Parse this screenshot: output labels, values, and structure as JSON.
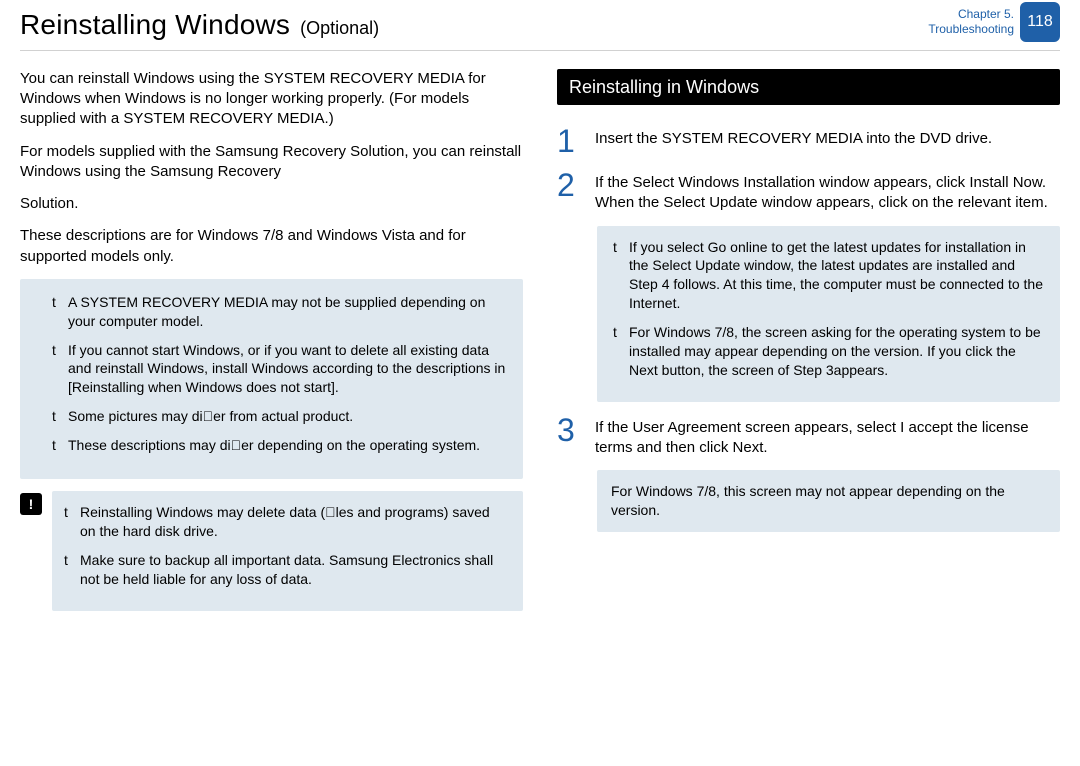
{
  "header": {
    "title": "Reinstalling Windows",
    "optional": "(Optional)",
    "chapter_line1": "Chapter 5.",
    "chapter_line2": "Troubleshooting",
    "page_number": "118"
  },
  "left": {
    "p1": "You can reinstall Windows using the SYSTEM RECOVERY MEDIA for Windows when Windows is no longer working properly. (For models supplied with a SYSTEM RECOVERY MEDIA.)",
    "p2": "For models supplied with the Samsung Recovery Solution, you can reinstall Windows using the Samsung Recovery",
    "p3": "Solution.",
    "p4": "These descriptions are for Windows 7/8 and Windows Vista and for supported models only.",
    "notes": {
      "n1": "A SYSTEM RECOVERY MEDIA may not be supplied depending on your computer model.",
      "n2": "If you cannot start Windows, or if you want to delete all existing data and reinstall Windows, install Windows according to the descriptions in [Reinstalling when Windows does not start].",
      "n3": "Some pictures may di\u0000er from actual product.",
      "n4": "These descriptions may di\u0000er depending on the operating system."
    },
    "warn": {
      "icon_label": "!",
      "w1": "Reinstalling Windows may delete data (\u0000les and programs) saved on the hard disk drive.",
      "w2": "Make sure to backup all important data. Samsung Electronics shall not be held liable for any loss of data."
    }
  },
  "right": {
    "section_title": "Reinstalling in Windows",
    "steps": {
      "s1": {
        "num": "1",
        "text": "Insert the SYSTEM RECOVERY MEDIA into the DVD drive."
      },
      "s2": {
        "num": "2",
        "text": "If the Select Windows Installation window appears, click Install Now. When the Select Update window appears, click on the relevant item."
      },
      "s3": {
        "num": "3",
        "text": "If the User Agreement screen appears, select I accept the license terms and then click Next."
      }
    },
    "step2_notes": {
      "a": "If you select Go online to get the latest updates for installation in the Select Update window, the latest updates are installed and Step 4 follows. At this time, the computer must be connected to the Internet.",
      "b": "For Windows 7/8, the screen asking for the operating system to be installed may appear depending on the version. If you click the Next button, the screen of Step 3appears."
    },
    "step3_note": "For Windows 7/8, this screen may not appear depending on the version."
  }
}
